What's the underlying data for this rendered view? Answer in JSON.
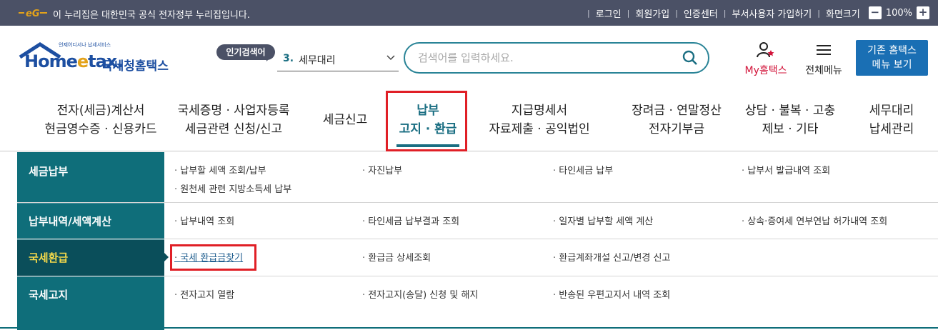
{
  "gov_bar": {
    "notice": "이 누리집은 대한민국 공식 전자정부 누리집입니다.",
    "links": [
      "로그인",
      "회원가입",
      "인증센터",
      "부서사용자 가입하기",
      "화면크기"
    ],
    "zoom_minus": "−",
    "zoom_value": "100%",
    "zoom_plus": "+"
  },
  "header": {
    "brand_small": "언제어디서나 납세서비스",
    "brand_home": "Home",
    "brand_e": "e",
    "brand_tax": "tax.",
    "brand_sub": "국세청홈택스",
    "popular_label": "인기검색어",
    "popular_rank": "3.",
    "popular_keyword": "세무대리",
    "search_placeholder": "검색어를 입력하세요.",
    "myhome_label": "My홈택스",
    "allmenu_label": "전체메뉴",
    "oldhome_line1": "기존 홈택스",
    "oldhome_line2": "메뉴 보기"
  },
  "nav": [
    {
      "line1": "전자(세금)계산서",
      "line2": "현금영수증 · 신용카드"
    },
    {
      "line1": "국세증명 · 사업자등록",
      "line2": "세금관련 신청/신고"
    },
    {
      "line1": "세금신고",
      "line2": ""
    },
    {
      "line1": "납부",
      "line2": "고지 · 환급"
    },
    {
      "line1": "지급명세서",
      "line2": "자료제출 · 공익법인"
    },
    {
      "line1": "장려금 · 연말정산",
      "line2": "전자기부금"
    },
    {
      "line1": "상담 · 불복 · 고충",
      "line2": "제보 · 기타"
    },
    {
      "line1": "세무대리",
      "line2": "납세관리"
    }
  ],
  "mega": [
    {
      "category": "세금납부",
      "links": [
        "납부할 세액 조회/납부",
        "자진납부",
        "타인세금 납부",
        "납부서 발급내역 조회",
        "원천세 관련 지방소득세 납부"
      ]
    },
    {
      "category": "납부내역/세액계산",
      "links": [
        "납부내역 조회",
        "타인세금 납부결과 조회",
        "일자별 납부할 세액 계산",
        "상속·증여세 연부연납 허가내역 조회"
      ]
    },
    {
      "category": "국세환급",
      "links": [
        "국세 환급금찾기",
        "환급금 상세조회",
        "환급계좌개설 신고/변경 신고"
      ]
    },
    {
      "category": "국세고지",
      "links": [
        "전자고지 열람",
        "전자고지(송달) 신청 및 해지",
        "반송된 우편고지서 내역 조회"
      ]
    }
  ],
  "colors": {
    "accent": "#0f6e7a",
    "highlight_box": "#e01f26",
    "gov_bar": "#4b5166",
    "button_blue": "#1a6fb4"
  }
}
